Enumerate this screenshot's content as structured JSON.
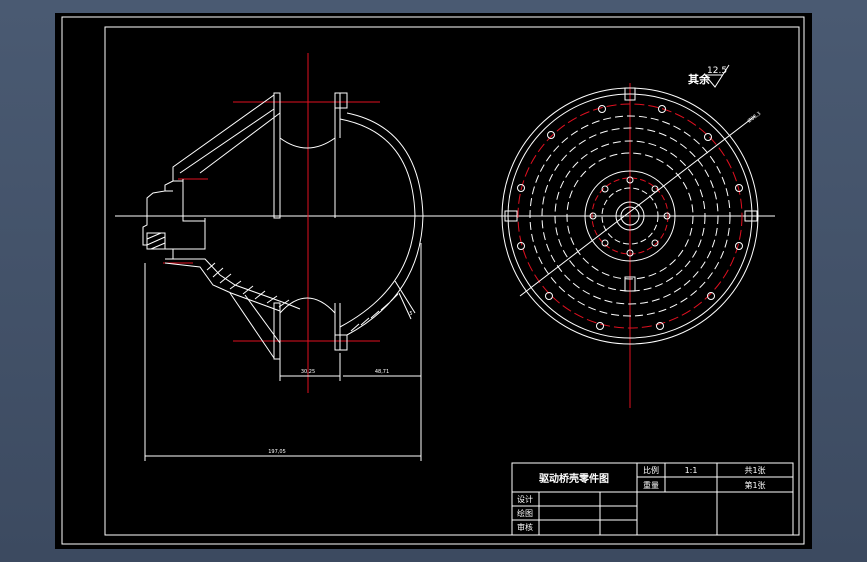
{
  "drawing": {
    "roughness_note": "其余",
    "roughness_value": "12.5",
    "dim_bottom_total": "197,05",
    "dim_shaft_width": "30,25",
    "dim_offset": "48,71",
    "dim_side": "5",
    "dim_diameter": "Ø88,3"
  },
  "title_block": {
    "title": "驱动桥壳零件图",
    "scale_label": "比例",
    "scale_value": "1:1",
    "weight_label": "重量",
    "sheets_total": "共1张",
    "sheet_no": "第1张",
    "design_label": "设计",
    "drawing_label": "绘图",
    "review_label": "审核"
  },
  "colors": {
    "line": "#ffffff",
    "centerline": "#e01020",
    "bolt_circle": "#e01020",
    "sheet": "#000000"
  }
}
